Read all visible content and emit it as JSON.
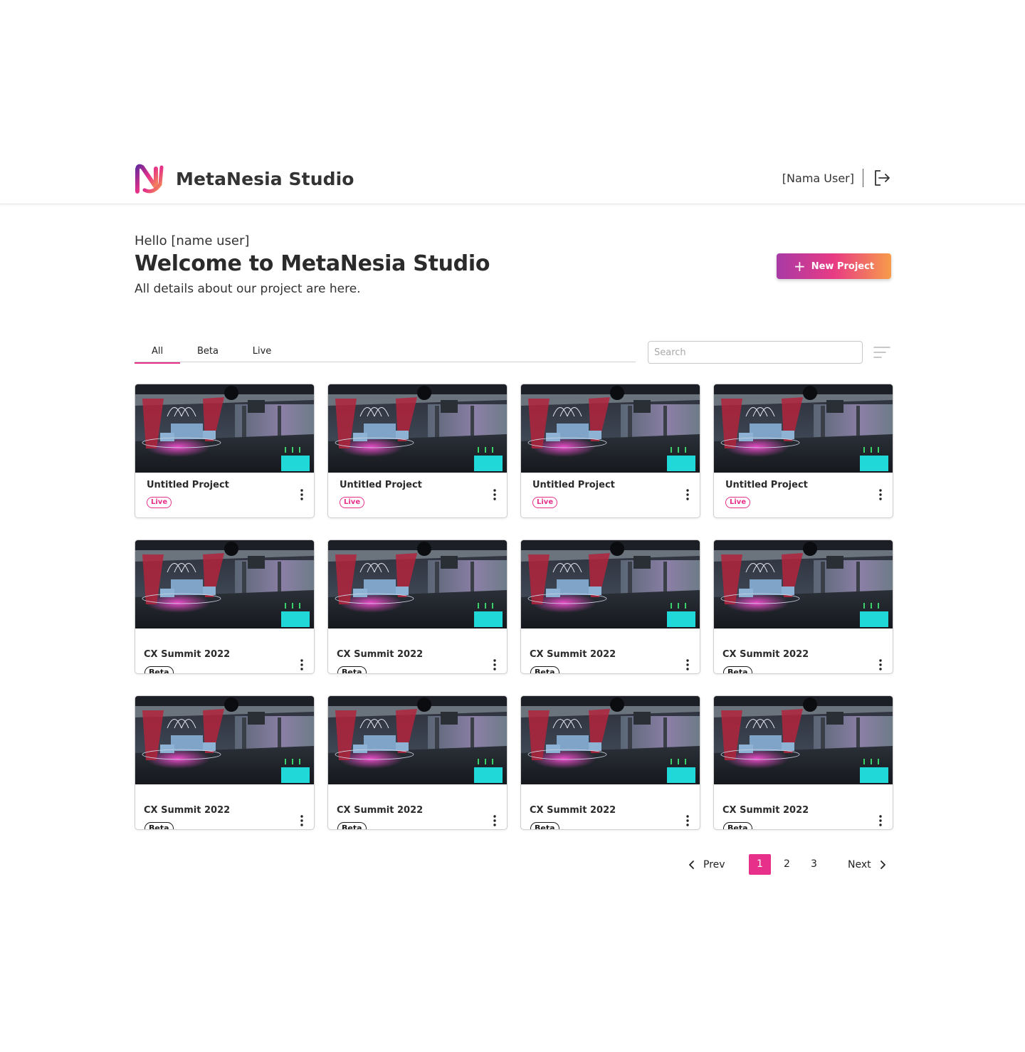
{
  "header": {
    "brand_name": "MetaNesia Studio",
    "user_name": "[Nama User]"
  },
  "hero": {
    "hello": "Hello [name user]",
    "title": "Welcome to MetaNesia Studio",
    "subtitle": "All details about our project are here.",
    "new_project_label": "New Project"
  },
  "tabs": [
    {
      "label": "All",
      "active": true
    },
    {
      "label": "Beta",
      "active": false
    },
    {
      "label": "Live",
      "active": false
    }
  ],
  "search": {
    "placeholder": "Search",
    "value": ""
  },
  "projects": [
    {
      "title": "Untitled Project",
      "status": "Live"
    },
    {
      "title": "Untitled Project",
      "status": "Live"
    },
    {
      "title": "Untitled Project",
      "status": "Live"
    },
    {
      "title": "Untitled Project",
      "status": "Live"
    },
    {
      "title": "CX Summit 2022",
      "status": "Beta"
    },
    {
      "title": "CX Summit 2022",
      "status": "Beta"
    },
    {
      "title": "CX Summit 2022",
      "status": "Beta"
    },
    {
      "title": "CX Summit 2022",
      "status": "Beta"
    },
    {
      "title": "CX Summit 2022",
      "status": "Beta"
    },
    {
      "title": "CX Summit 2022",
      "status": "Beta"
    },
    {
      "title": "CX Summit 2022",
      "status": "Beta"
    },
    {
      "title": "CX Summit 2022",
      "status": "Beta"
    }
  ],
  "pagination": {
    "prev_label": "Prev",
    "next_label": "Next",
    "pages": [
      "1",
      "2",
      "3"
    ],
    "current_page": "1"
  },
  "colors": {
    "accent": "#e6308a",
    "gradient_start": "#a83aa5",
    "gradient_end": "#f79c4a"
  },
  "icons": {
    "logo": "metanesia-logo-icon",
    "logout": "logout-icon",
    "plus": "plus-icon",
    "filter": "filter-sort-icon",
    "more": "more-vertical-icon",
    "prev": "chevron-left-icon",
    "next": "chevron-right-icon"
  }
}
